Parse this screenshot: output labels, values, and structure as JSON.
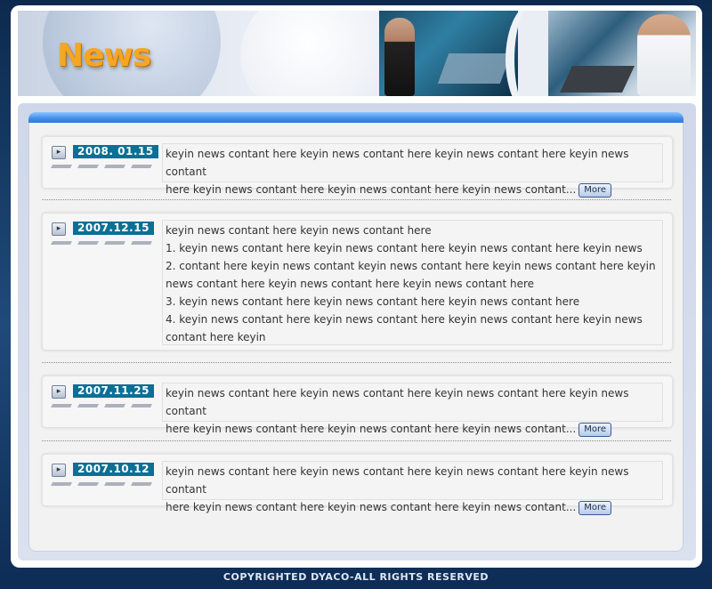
{
  "header": {
    "title": "News"
  },
  "news_items": [
    {
      "date": "2008. 01.15",
      "lines": [
        "keyin news contant here keyin news contant here keyin news contant here keyin news contant",
        "here keyin news contant here keyin news contant here keyin news contant..."
      ],
      "more_label": "More"
    },
    {
      "date": "2007.12.15",
      "lines": [
        "keyin news contant here keyin news contant here",
        "1.  keyin news contant here keyin news contant here keyin news contant here keyin news",
        "2.  contant here keyin news contant keyin news contant here keyin news contant here keyin",
        "news contant here keyin news contant here keyin news contant here",
        "3.  keyin news contant here keyin news contant here keyin news contant here",
        "4.  keyin news contant here keyin news contant here keyin news contant here keyin news",
        "contant here keyin"
      ]
    },
    {
      "date": "2007.11.25",
      "lines": [
        "keyin news contant here keyin news contant here keyin news contant here keyin news contant",
        "here keyin news contant here keyin news contant here keyin news contant..."
      ],
      "more_label": "More"
    },
    {
      "date": "2007.10.12",
      "lines": [
        "keyin news contant here keyin news contant here keyin news contant here keyin news contant",
        "here keyin news contant here keyin news contant here keyin news contant..."
      ],
      "more_label": "More"
    }
  ],
  "footer": {
    "copyright": "COPYRIGHTED DYACO-ALL RIGHTS RESERVED"
  },
  "colors": {
    "title": "#f5a623",
    "date_badge": "#0c6f95",
    "frame": "#1a3a63",
    "accent_bar": "#3f8ee8"
  },
  "icons": {
    "item_arrow": "chevron-right-icon"
  }
}
